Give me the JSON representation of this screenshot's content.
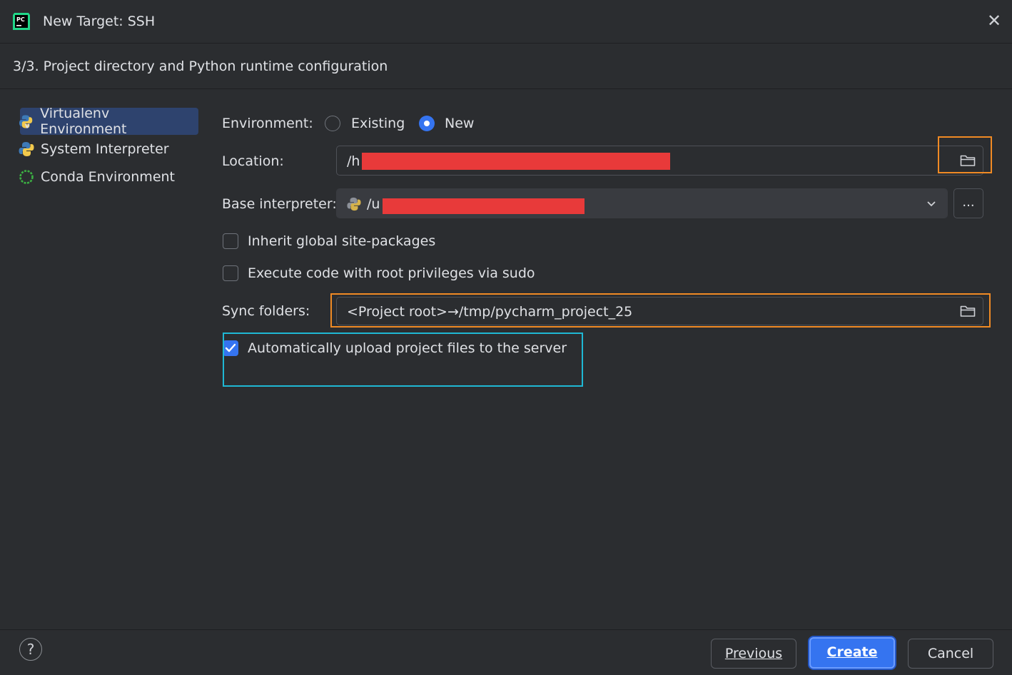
{
  "window": {
    "title": "New Target: SSH",
    "close_glyph": "✕"
  },
  "header": {
    "step": "3/3. Project directory and Python runtime configuration"
  },
  "sidebar": {
    "items": [
      {
        "label": "Virtualenv Environment",
        "icon": "virtualenv-icon",
        "selected": true
      },
      {
        "label": "System Interpreter",
        "icon": "python-icon",
        "selected": false
      },
      {
        "label": "Conda Environment",
        "icon": "conda-icon",
        "selected": false
      }
    ]
  },
  "form": {
    "environment_label": "Environment:",
    "env_options": [
      {
        "label": "Existing",
        "selected": false
      },
      {
        "label": "New",
        "selected": true
      }
    ],
    "location_label": "Location:",
    "location_value_visible": "/h",
    "base_interpreter_label": "Base interpreter:",
    "base_interpreter_value_visible": "/u",
    "browse_label": "...",
    "inherit_label": "Inherit global site-packages",
    "inherit_checked": false,
    "sudo_label": "Execute code with root privileges via sudo",
    "sudo_checked": false,
    "sync_label": "Sync folders:",
    "sync_value": "<Project root>→/tmp/pycharm_project_25",
    "auto_upload_label": "Automatically upload project files to the server",
    "auto_upload_checked": true
  },
  "footer": {
    "help_glyph": "?",
    "previous_label": "Previous",
    "create_label": "Create",
    "cancel_label": "Cancel"
  },
  "colors": {
    "background": "#2b2d30",
    "accent": "#3574f0",
    "highlight_orange": "#f08a24",
    "highlight_cyan": "#1fb8d4",
    "redaction": "#e83a3a"
  }
}
